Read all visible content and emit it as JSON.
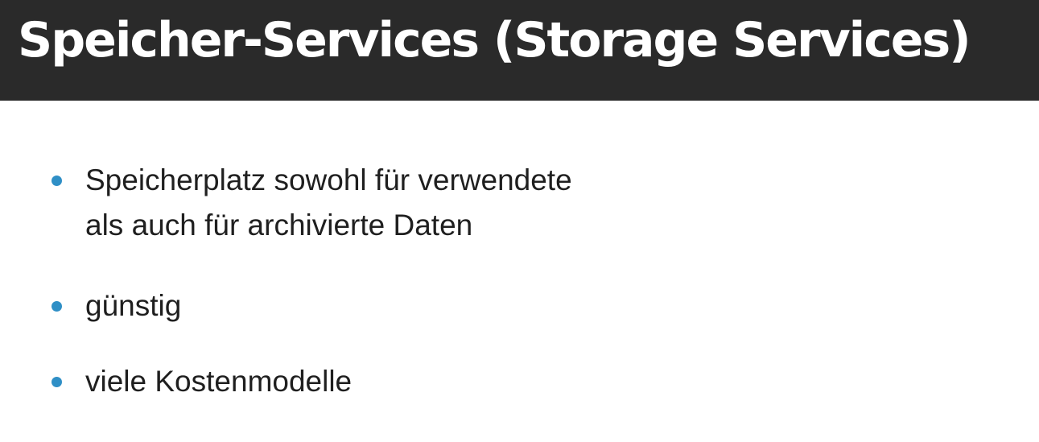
{
  "slide": {
    "title": "Speicher-Services (Storage Services)",
    "accent_color": "#2f8fc6",
    "header_color": "#2a2a2a",
    "bullets": [
      {
        "lines": [
          "Speicherplatz sowohl für verwendete",
          "als auch für archivierte Daten"
        ]
      },
      {
        "lines": [
          "günstig"
        ]
      },
      {
        "lines": [
          "viele Kostenmodelle"
        ]
      }
    ]
  }
}
